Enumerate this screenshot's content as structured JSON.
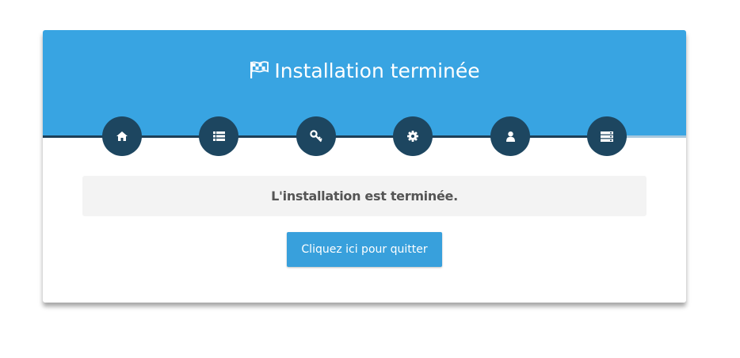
{
  "header": {
    "title": "Installation terminée",
    "icon": "checkered-flag-icon",
    "background_color": "#38a4e2"
  },
  "steps": [
    {
      "icon": "home-icon"
    },
    {
      "icon": "list-icon"
    },
    {
      "icon": "key-icon"
    },
    {
      "icon": "gear-icon"
    },
    {
      "icon": "user-icon"
    },
    {
      "icon": "server-icon"
    }
  ],
  "steps_color": "#1d4660",
  "message": {
    "text": "L'installation est terminée."
  },
  "quit_button": {
    "label": "Cliquez ici pour quitter",
    "color": "#38a0dc"
  }
}
